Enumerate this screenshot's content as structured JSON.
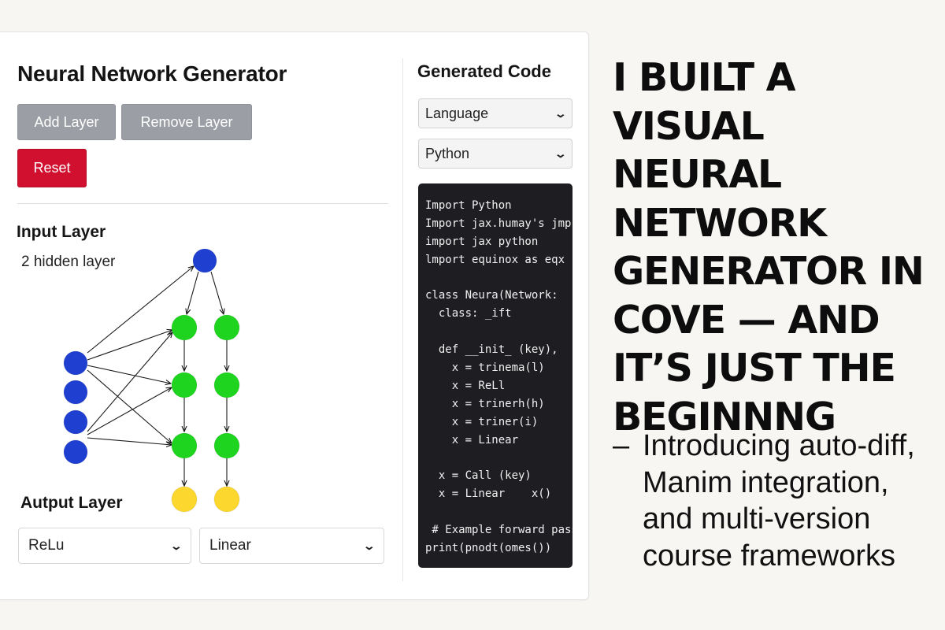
{
  "app": {
    "title": "Neural Network Generator",
    "buttons": {
      "add_layer": "Add Layer",
      "remove_layer": "Remove Layer",
      "reset": "Reset"
    },
    "labels": {
      "input_layer": "Input Layer",
      "hidden_layers": "2 hidden layer",
      "output_layer": "Autput Layer"
    },
    "activation_selects": [
      {
        "value": "ReLu"
      },
      {
        "value": "Linear"
      }
    ]
  },
  "network": {
    "input_nodes": 4,
    "hidden_layers": 2,
    "hidden_nodes_per_layer": 3,
    "output_nodes": 2,
    "colors": {
      "input": "#1f3fd1",
      "hidden": "#1ed41e",
      "output": "#fcd82e"
    }
  },
  "code_panel": {
    "title": "Generated Code",
    "language_select": "Language",
    "python_select": "Python",
    "lines": [
      "Import Python",
      "Import jax.humay's jmp",
      "import jax python",
      "lmport equinox as eqx",
      "",
      "class Neura(Network:",
      "  class: _ift",
      "",
      "  def __init_ (key),",
      "    x = trinema(l)",
      "    x = ReLl",
      "    x = trinerh(h)",
      "    x = triner(i)",
      "    x = Linear",
      "",
      "  x = Call (key)",
      "  x = Linear    x()",
      "",
      " # Example forward pass",
      "print(pnodt(omes())"
    ]
  },
  "headline": "I BUILT A VISUAL NEURAL NETWORK GENERATOR IN COVE — AND IT’S JUST THE BEGINNNG",
  "bullet": {
    "dash": "–",
    "text": "Introducing auto-diff, Manim integration, and multi-version course frameworks"
  }
}
